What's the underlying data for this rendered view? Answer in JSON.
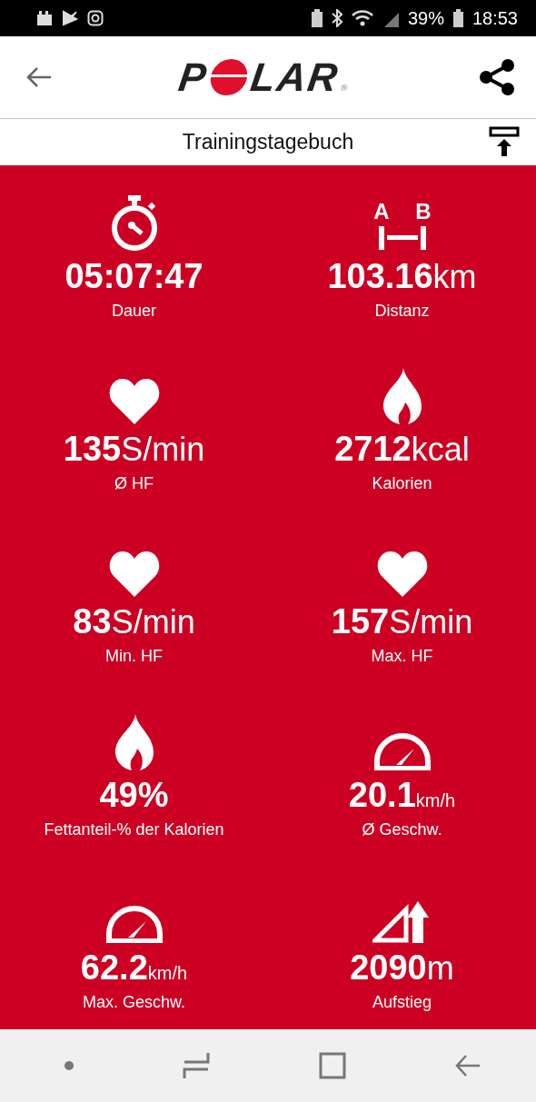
{
  "status_bar": {
    "battery": "39%",
    "time": "18:53"
  },
  "header": {
    "logo": {
      "start": "P",
      "end": "LAR",
      "mark": "®"
    }
  },
  "subheader": {
    "title": "Trainingstagebuch"
  },
  "distance_icon": {
    "labels": [
      "A",
      "B"
    ]
  },
  "stats": [
    {
      "kind": "stopwatch",
      "value": "05:07:47",
      "label": "Dauer"
    },
    {
      "kind": "distance",
      "value": "103.16",
      "unit": "km",
      "label": "Distanz"
    },
    {
      "kind": "heart",
      "value": "135",
      "unit": "S/min",
      "label": "Ø HF"
    },
    {
      "kind": "flame",
      "value": "2712",
      "unit": "kcal",
      "label": "Kalorien"
    },
    {
      "kind": "heart",
      "value": "83",
      "unit": "S/min",
      "label": "Min. HF"
    },
    {
      "kind": "heart",
      "value": "157",
      "unit": "S/min",
      "label": "Max. HF"
    },
    {
      "kind": "flame",
      "value": "49%",
      "label": "Fettanteil-% der Kalorien"
    },
    {
      "kind": "gauge",
      "value": "20.1",
      "unit": "km/h",
      "label": "Ø Geschw."
    },
    {
      "kind": "gauge",
      "value": "62.2",
      "unit": "km/h",
      "label": "Max. Geschw."
    },
    {
      "kind": "ascent",
      "value": "2090",
      "unit": "m",
      "label": "Aufstieg"
    }
  ]
}
